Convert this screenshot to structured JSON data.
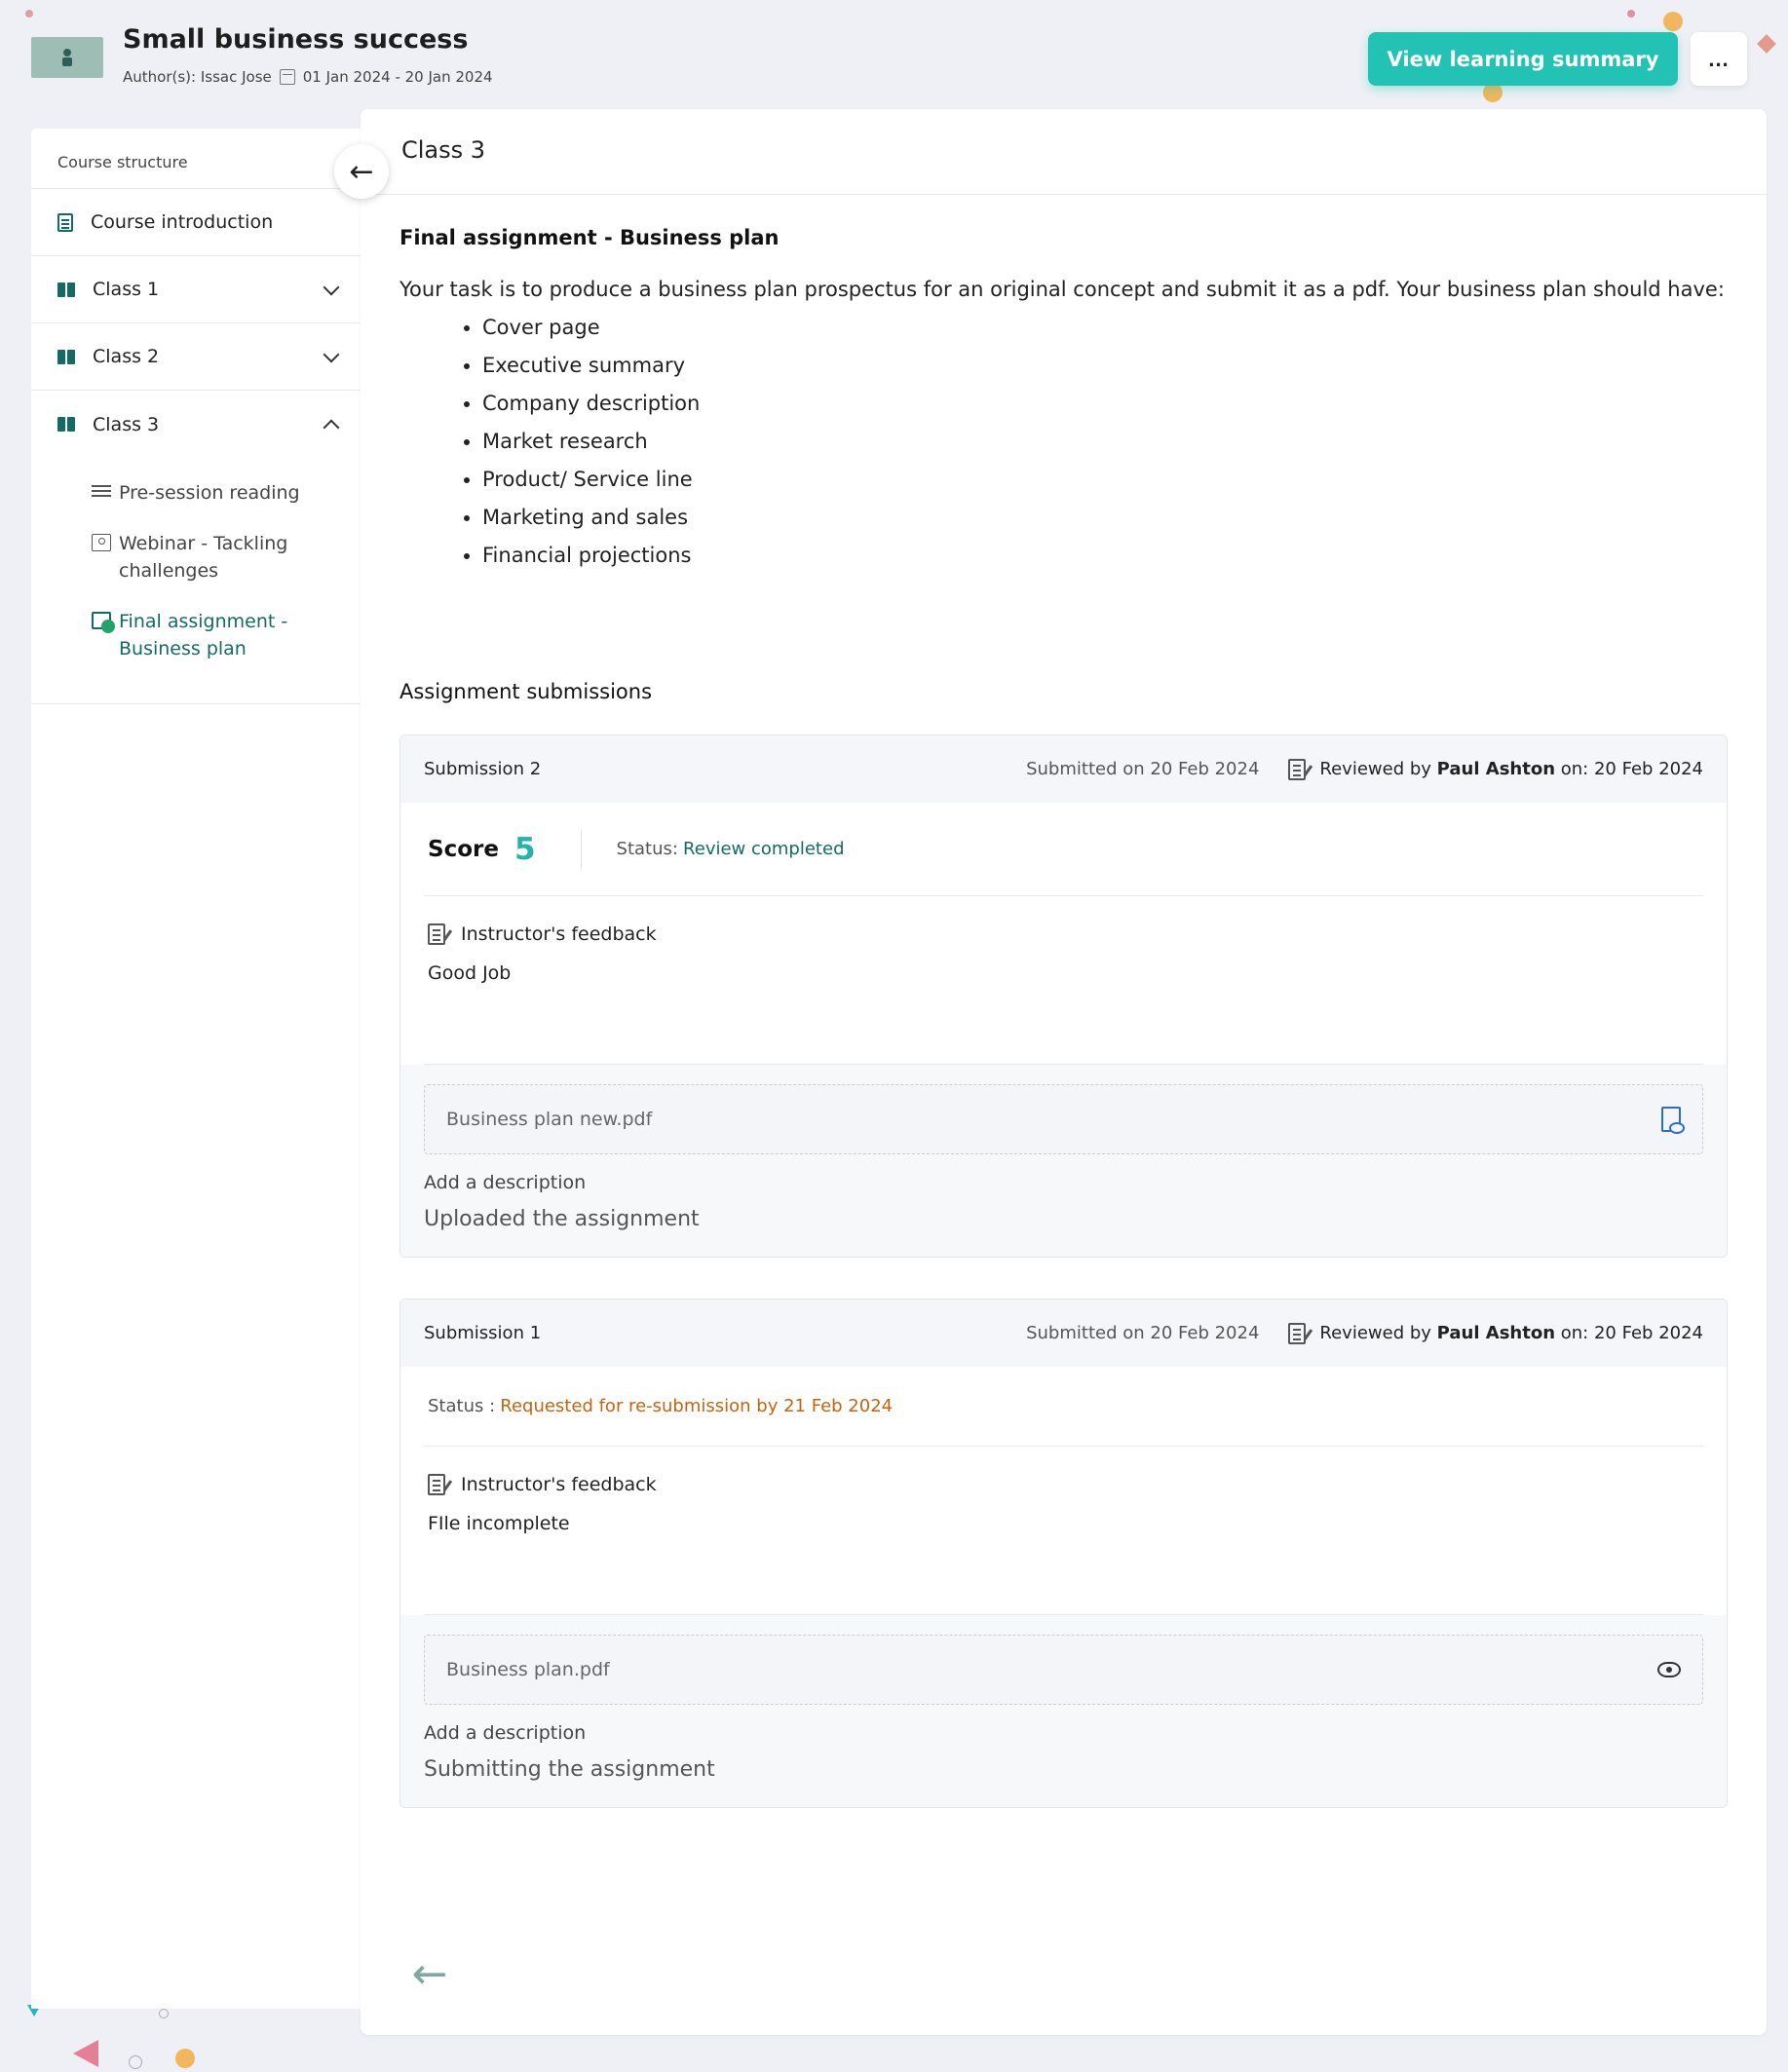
{
  "header": {
    "title": "Small business success",
    "authors": "Author(s): Issac Jose",
    "date_range": "01 Jan 2024 - 20 Jan 2024",
    "summary_button": "View learning summary",
    "more_button": "..."
  },
  "sidebar": {
    "heading": "Course structure",
    "intro": "Course introduction",
    "classes": [
      {
        "label": "Class 1"
      },
      {
        "label": "Class 2"
      },
      {
        "label": "Class 3"
      }
    ],
    "class3_items": [
      {
        "label": "Pre-session reading"
      },
      {
        "label": "Webinar - Tackling challenges"
      },
      {
        "label": "Final assignment - Business plan"
      }
    ]
  },
  "main": {
    "title": "Class 3",
    "assignment_title": "Final assignment - Business plan",
    "assignment_desc": "Your task is to produce a business plan prospectus for an original concept and submit it as a pdf. Your business plan should have:",
    "requirements": [
      "Cover page",
      "Executive summary",
      "Company description",
      "Market research",
      "Product/ Service line",
      "Marketing and sales",
      "Financial projections"
    ],
    "submissions_title": "Assignment submissions"
  },
  "submissions": [
    {
      "name": "Submission 2",
      "submitted": "Submitted on 20 Feb 2024",
      "reviewed_prefix": "Reviewed by",
      "reviewer": "Paul Ashton",
      "reviewed_suffix": "on: 20 Feb 2024",
      "score_label": "Score",
      "score": "5",
      "status_label": "Status:",
      "status": "Review completed",
      "feedback_label": "Instructor's feedback",
      "feedback": "Good Job",
      "file": "Business plan new.pdf",
      "desc_label": "Add a description",
      "desc": "Uploaded the assignment"
    },
    {
      "name": "Submission 1",
      "submitted": "Submitted on 20 Feb 2024",
      "reviewed_prefix": "Reviewed by",
      "reviewer": "Paul Ashton",
      "reviewed_suffix": "on: 20 Feb 2024",
      "status_label": "Status :",
      "status": "Requested for re-submission by 21 Feb 2024",
      "feedback_label": "Instructor's feedback",
      "feedback": "FIle incomplete",
      "file": "Business plan.pdf",
      "desc_label": "Add a description",
      "desc": "Submitting the assignment"
    }
  ],
  "colors": {
    "accent": "#22c3b5",
    "primary_dark": "#136b63",
    "warning": "#c46410"
  }
}
